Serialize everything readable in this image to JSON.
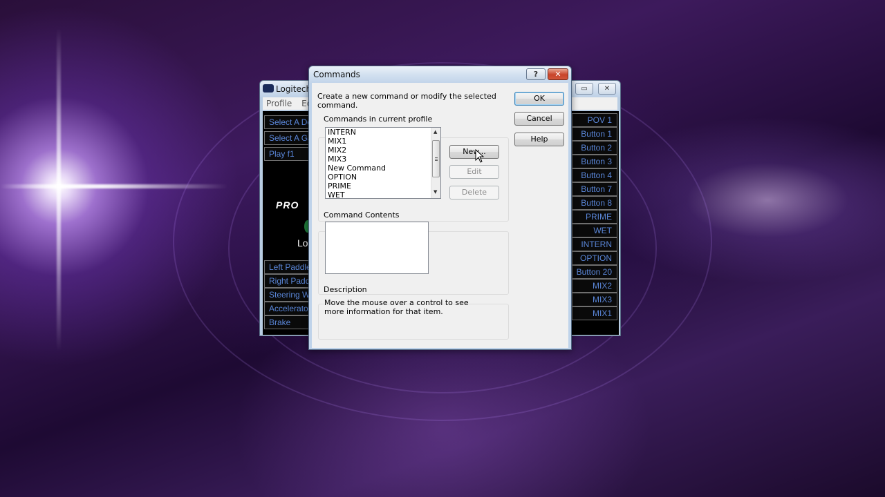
{
  "background_window": {
    "title": "Logitech",
    "menu": [
      "Profile",
      "Edi"
    ],
    "left_items_top": [
      "Select A De",
      "Select A Ga",
      "Play f1"
    ],
    "left_items_bottom": [
      "Left Paddle",
      "Right Paddl",
      "Steering W",
      "Accelerato",
      "Brake"
    ],
    "logo_fragments": {
      "pro": "PRO",
      "lo": "Lo"
    },
    "right_items": [
      "POV 1",
      "Button 1",
      "Button 2",
      "Button 3",
      "Button 4",
      "Button 7",
      "Button 8",
      "PRIME",
      "WET",
      "INTERN",
      "OPTION",
      "Button 20",
      "MIX2",
      "MIX3",
      "MIX1"
    ]
  },
  "dialog": {
    "title": "Commands",
    "help_glyph": "?",
    "close_glyph": "✕",
    "intro": "Create a new command or modify the selected command.",
    "commands_label": "Commands in current profile",
    "commands": [
      "INTERN",
      "MIX1",
      "MIX2",
      "MIX3",
      "New Command",
      "OPTION",
      "PRIME",
      "WET"
    ],
    "buttons": {
      "new": "New...",
      "edit": "Edit",
      "delete": "Delete",
      "ok": "OK",
      "cancel": "Cancel",
      "help": "Help"
    },
    "contents_label": "Command Contents",
    "description_label": "Description",
    "description_text": "Move the mouse over a control to see more information for that item."
  },
  "colors": {
    "accent_text": "#5a86d8",
    "dialog_frame": "#bfd3ea",
    "close_red": "#c8432a"
  }
}
